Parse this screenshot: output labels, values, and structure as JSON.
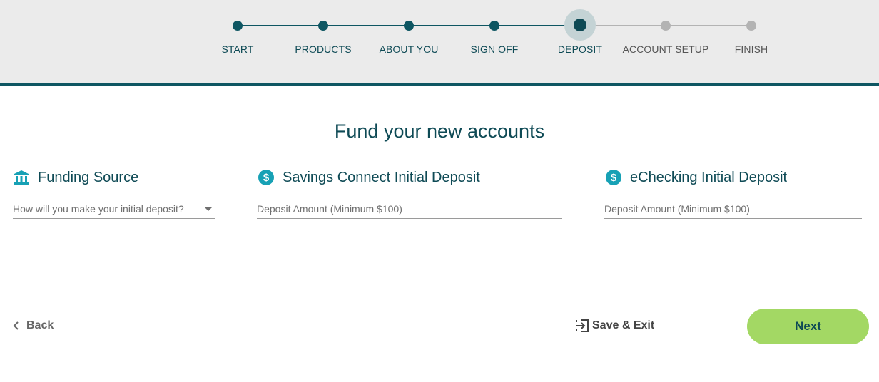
{
  "stepper": {
    "steps": [
      {
        "label": "START",
        "state": "done"
      },
      {
        "label": "PRODUCTS",
        "state": "done"
      },
      {
        "label": "ABOUT YOU",
        "state": "done"
      },
      {
        "label": "SIGN OFF",
        "state": "done"
      },
      {
        "label": "DEPOSIT",
        "state": "current"
      },
      {
        "label": "ACCOUNT SETUP",
        "state": "todo"
      },
      {
        "label": "FINISH",
        "state": "todo"
      }
    ]
  },
  "page": {
    "title": "Fund your new accounts"
  },
  "sections": {
    "funding": {
      "title": "Funding Source",
      "icon": "bank-icon",
      "placeholder": "How will you make your initial deposit?"
    },
    "savings": {
      "title": "Savings Connect Initial Deposit",
      "icon": "dollar-coin-icon",
      "placeholder": "Deposit Amount (Minimum $100)"
    },
    "checking": {
      "title": "eChecking Initial Deposit",
      "icon": "dollar-coin-icon",
      "placeholder": "Deposit Amount (Minimum $100)"
    }
  },
  "footer": {
    "back_label": "Back",
    "save_exit_label": "Save & Exit",
    "next_label": "Next"
  },
  "colors": {
    "primary": "#0e5662",
    "accent_icon": "#17a1b5",
    "next_button": "#a3d864",
    "inactive_step": "#b3b3b3"
  }
}
